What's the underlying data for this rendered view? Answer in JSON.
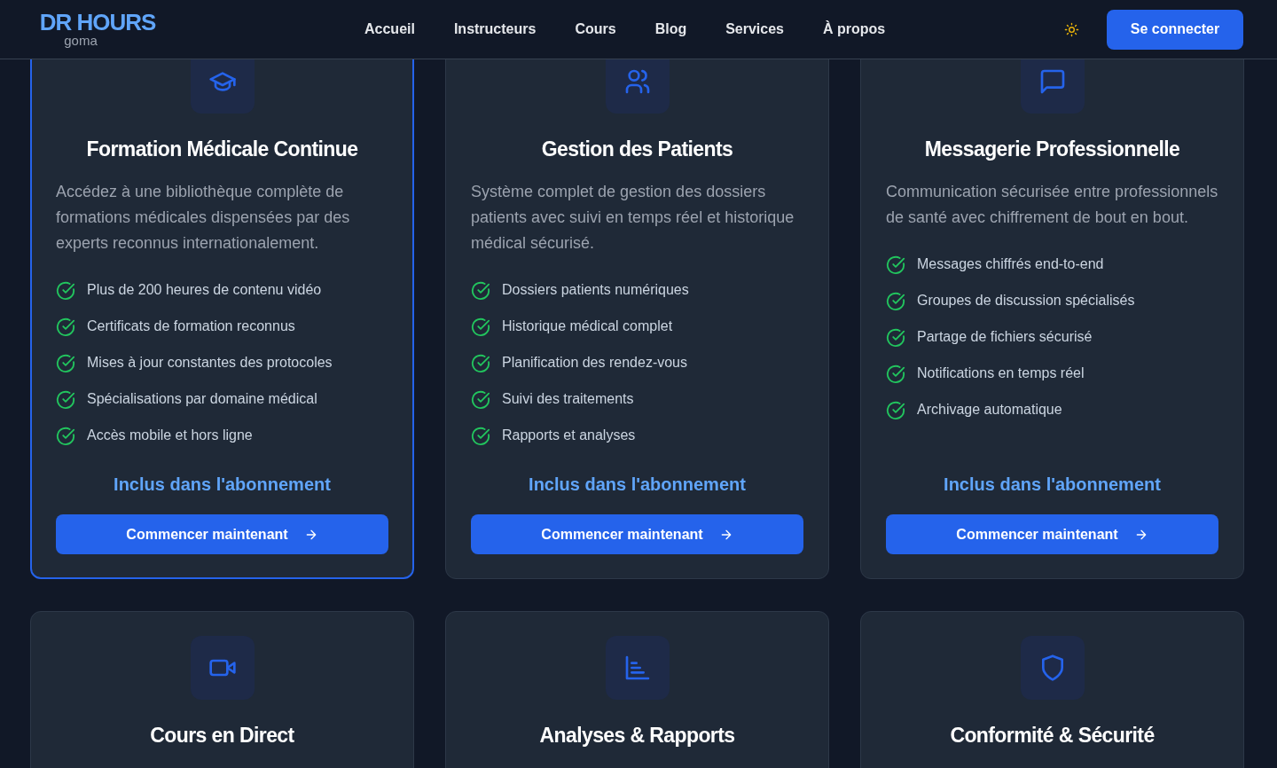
{
  "header": {
    "logo": "DR HOURS",
    "logo_subtitle": "goma",
    "nav": [
      "Accueil",
      "Instructeurs",
      "Cours",
      "Blog",
      "Services",
      "À propos"
    ],
    "login_button": "Se connecter"
  },
  "cards": [
    {
      "title": "Formation Médicale Continue",
      "highlighted": true,
      "description": "Accédez à une bibliothèque complète de formations médicales dispensées par des experts reconnus internationalement.",
      "features": [
        "Plus de 200 heures de contenu vidéo",
        "Certificats de formation reconnus",
        "Mises à jour constantes des protocoles",
        "Spécialisations par domaine médical",
        "Accès mobile et hors ligne"
      ],
      "price": "Inclus dans l'abonnement",
      "button": "Commencer maintenant"
    },
    {
      "title": "Gestion des Patients",
      "highlighted": false,
      "description": "Système complet de gestion des dossiers patients avec suivi en temps réel et historique médical sécurisé.",
      "features": [
        "Dossiers patients numériques",
        "Historique médical complet",
        "Planification des rendez-vous",
        "Suivi des traitements",
        "Rapports et analyses"
      ],
      "price": "Inclus dans l'abonnement",
      "button": "Commencer maintenant"
    },
    {
      "title": "Messagerie Professionnelle",
      "highlighted": false,
      "description": "Communication sécurisée entre professionnels de santé avec chiffrement de bout en bout.",
      "features": [
        "Messages chiffrés end-to-end",
        "Groupes de discussion spécialisés",
        "Partage de fichiers sécurisé",
        "Notifications en temps réel",
        "Archivage automatique"
      ],
      "price": "Inclus dans l'abonnement",
      "button": "Commencer maintenant"
    },
    {
      "title": "Cours en Direct",
      "highlighted": false
    },
    {
      "title": "Analyses & Rapports",
      "highlighted": false
    },
    {
      "title": "Conformité & Sécurité",
      "highlighted": false
    }
  ]
}
